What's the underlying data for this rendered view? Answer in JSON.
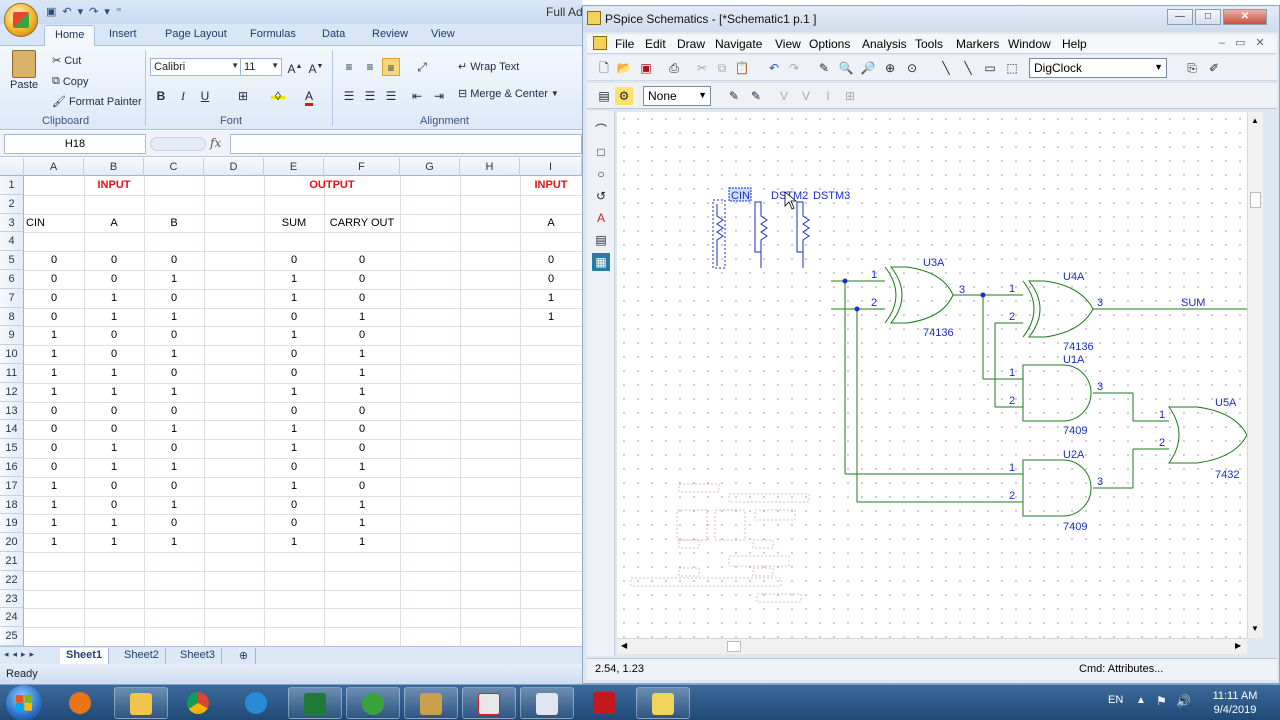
{
  "excel": {
    "title": "Full Ad",
    "tabs": [
      "Home",
      "Insert",
      "Page Layout",
      "Formulas",
      "Data",
      "Review",
      "View"
    ],
    "clipboard": {
      "paste": "Paste",
      "cut": "Cut",
      "copy": "Copy",
      "format_painter": "Format Painter",
      "label": "Clipboard"
    },
    "font": {
      "name": "Calibri",
      "size": "11",
      "label": "Font",
      "bold": "B",
      "italic": "I",
      "underline": "U"
    },
    "alignment": {
      "wrap_text": "Wrap Text",
      "merge_center": "Merge & Center",
      "label": "Alignment"
    },
    "name_box": "H18",
    "fx": "fx",
    "columns": [
      "A",
      "B",
      "C",
      "D",
      "E",
      "F",
      "G",
      "H",
      "I"
    ],
    "rows": [
      "1",
      "2",
      "3",
      "4",
      "5",
      "6",
      "7",
      "8",
      "9",
      "10",
      "11",
      "12",
      "13",
      "14",
      "15",
      "16",
      "17",
      "18",
      "19",
      "20",
      "21",
      "22",
      "23",
      "24",
      "25"
    ],
    "header_row1": {
      "b": "INPUT",
      "ef": "OUTPUT",
      "i": "INPUT"
    },
    "header_row3": {
      "a": "CIN",
      "b": "A",
      "c": "B",
      "e": "SUM",
      "f": "CARRY OUT",
      "i": "A"
    },
    "data": [
      [
        "0",
        "0",
        "0",
        "0",
        "0",
        "0"
      ],
      [
        "0",
        "0",
        "1",
        "1",
        "0",
        "0"
      ],
      [
        "0",
        "1",
        "0",
        "1",
        "0",
        "1"
      ],
      [
        "0",
        "1",
        "1",
        "0",
        "1",
        "1"
      ],
      [
        "1",
        "0",
        "0",
        "1",
        "0",
        ""
      ],
      [
        "1",
        "0",
        "1",
        "0",
        "1",
        ""
      ],
      [
        "1",
        "1",
        "0",
        "0",
        "1",
        ""
      ],
      [
        "1",
        "1",
        "1",
        "1",
        "1",
        ""
      ],
      [
        "0",
        "0",
        "0",
        "0",
        "0",
        ""
      ],
      [
        "0",
        "0",
        "1",
        "1",
        "0",
        ""
      ],
      [
        "0",
        "1",
        "0",
        "1",
        "0",
        ""
      ],
      [
        "0",
        "1",
        "1",
        "0",
        "1",
        ""
      ],
      [
        "1",
        "0",
        "0",
        "1",
        "0",
        ""
      ],
      [
        "1",
        "0",
        "1",
        "0",
        "1",
        ""
      ],
      [
        "1",
        "1",
        "0",
        "0",
        "1",
        ""
      ],
      [
        "1",
        "1",
        "1",
        "1",
        "1",
        ""
      ]
    ],
    "sheets": [
      "Sheet1",
      "Sheet2",
      "Sheet3"
    ],
    "status": "Ready"
  },
  "pspice": {
    "title": "PSpice Schematics - [*Schematic1  p.1 ]",
    "menus": [
      "File",
      "Edit",
      "Draw",
      "Navigate",
      "View",
      "Options",
      "Analysis",
      "Tools",
      "Markers",
      "Window",
      "Help"
    ],
    "part_combo": "DigClock",
    "none_combo": "None",
    "status_coords": "2.54, 1.23",
    "status_cmd": "Cmd: Attributes...",
    "schematic": {
      "stim_labels": [
        "CIN",
        "DSTM2",
        "DSTM3"
      ],
      "u3a": {
        "ref": "U3A",
        "part": "74136",
        "p1": "1",
        "p2": "2",
        "p3": "3"
      },
      "u4a": {
        "ref": "U4A",
        "part": "74136",
        "p1": "1",
        "p2": "2",
        "p3": "3"
      },
      "u1a": {
        "ref": "U1A",
        "part": "7409",
        "p1": "1",
        "p2": "2",
        "p3": "3"
      },
      "u2a": {
        "ref": "U2A",
        "part": "7409",
        "p1": "1",
        "p2": "2",
        "p3": "3"
      },
      "u5a": {
        "ref": "U5A",
        "part": "7432",
        "p1": "1",
        "p2": "2"
      },
      "sum_label": "SUM"
    }
  },
  "taskbar": {
    "lang": "EN",
    "time": "11:11 AM",
    "date": "9/4/2019"
  }
}
